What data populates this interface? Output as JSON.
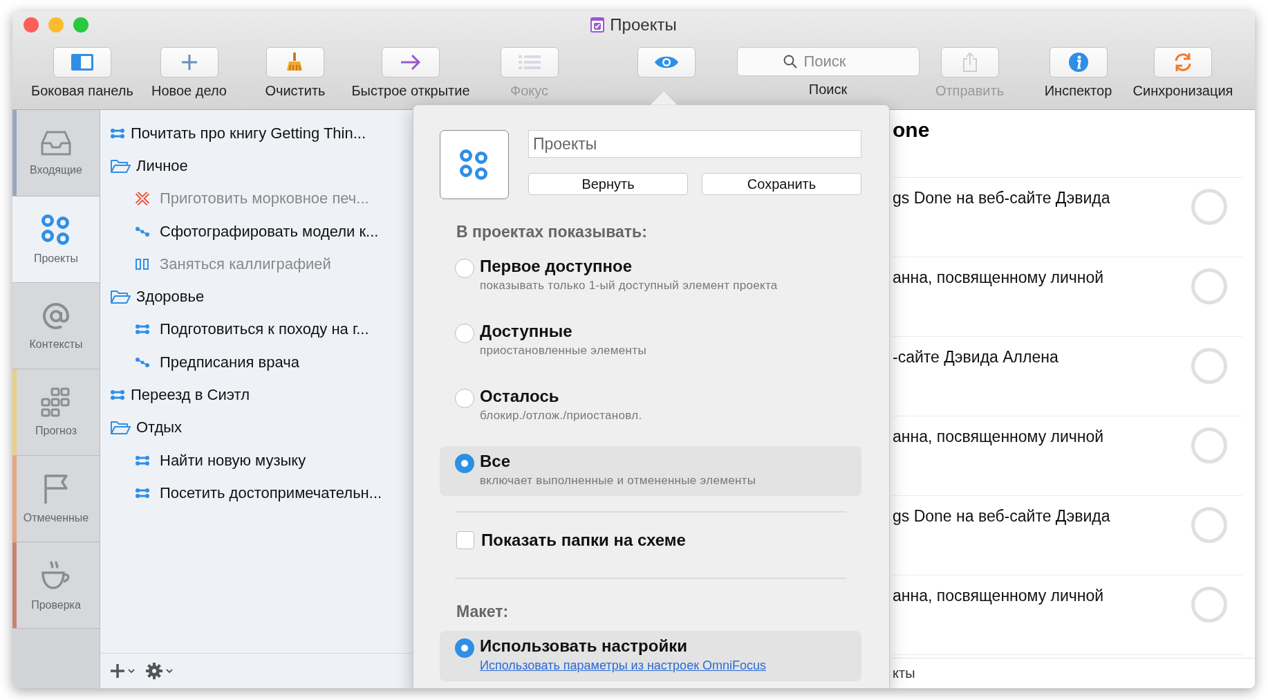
{
  "window": {
    "title": "Проекты"
  },
  "toolbar": [
    {
      "kind": "sidebar",
      "label": "Боковая панель",
      "disabled": false
    },
    {
      "kind": "new",
      "label": "Новое дело",
      "disabled": false
    },
    {
      "kind": "clean",
      "label": "Очистить",
      "disabled": false
    },
    {
      "kind": "quick-open",
      "label": "Быстрое открытие",
      "disabled": false
    },
    {
      "kind": "focus",
      "label": "Фокус",
      "disabled": true
    },
    {
      "kind": "view",
      "disabled": false
    },
    {
      "kind": "search",
      "placeholder": "Поиск",
      "label": "Поиск",
      "disabled": false
    },
    {
      "kind": "share",
      "label": "Отправить",
      "disabled": true
    },
    {
      "kind": "inspector",
      "label": "Инспектор",
      "disabled": false
    },
    {
      "kind": "sync",
      "label": "Синхронизация",
      "disabled": false
    }
  ],
  "sidebar_tabs": [
    {
      "kind": "inbox",
      "label": "Входящие",
      "selected": false,
      "color": "#97a6bb"
    },
    {
      "kind": "projects",
      "label": "Проекты",
      "selected": true
    },
    {
      "kind": "contexts",
      "label": "Контексты",
      "selected": false
    },
    {
      "kind": "forecast",
      "label": "Прогноз",
      "selected": false,
      "color": "#e8cf86"
    },
    {
      "kind": "flagged",
      "label": "Отмеченные",
      "selected": false,
      "color": "#e3a882"
    },
    {
      "kind": "review",
      "label": "Проверка",
      "selected": false,
      "color": "#c88473"
    }
  ],
  "outline": [
    {
      "kind": "parallel",
      "label": "Почитать про книгу Getting Thin...",
      "dimmed": false
    },
    {
      "kind": "folder",
      "label": "Личное",
      "dimmed": false,
      "children": [
        {
          "kind": "dropped",
          "label": "Приготовить морковное печ...",
          "dimmed": true
        },
        {
          "kind": "sequential",
          "label": "Сфотографировать модели к...",
          "dimmed": false
        },
        {
          "kind": "on-hold",
          "label": "Заняться каллиграфией",
          "dimmed": true
        }
      ]
    },
    {
      "kind": "folder",
      "label": "Здоровье",
      "dimmed": false,
      "children": [
        {
          "kind": "parallel",
          "label": "Подготовиться к походу на г...",
          "dimmed": false
        },
        {
          "kind": "sequential",
          "label": "Предписания врача",
          "dimmed": false
        }
      ]
    },
    {
      "kind": "parallel",
      "label": "Переезд в Сиэтл",
      "dimmed": false
    },
    {
      "kind": "folder",
      "label": "Отдых",
      "dimmed": false,
      "children": [
        {
          "kind": "parallel",
          "label": "Найти новую музыку",
          "dimmed": false
        },
        {
          "kind": "parallel",
          "label": "Посетить достопримечательн...",
          "dimmed": false
        }
      ]
    }
  ],
  "popover": {
    "name_field": {
      "value": "Проекты"
    },
    "buttons": [
      "Вернуть",
      "Сохранить"
    ],
    "show_heading": "В проектах показывать:",
    "show_options": [
      {
        "title": "Первое доступное",
        "subtitle": "показывать только 1-ый доступный элемент проекта",
        "selected": false
      },
      {
        "title": "Доступные",
        "subtitle": "приостановленные элементы",
        "selected": false
      },
      {
        "title": "Осталось",
        "subtitle": "блокир./отлож./приостановл.",
        "selected": false
      },
      {
        "title": "Все",
        "subtitle": "включает выполненные и отмененные элементы",
        "selected": true
      }
    ],
    "folders_checkbox": {
      "label": "Показать папки на схеме",
      "checked": false
    },
    "layout_heading": "Макет:",
    "layout_options": [
      {
        "title": "Использовать настройки",
        "link": "Использовать параметры из настроек OmniFocus",
        "selected": true
      }
    ]
  },
  "content": {
    "heading": "one",
    "rows": [
      {
        "text": "gs Done на веб-сайте Дэвида",
        "checked": false
      },
      {
        "text": "анна, посвященному личной",
        "checked": false
      },
      {
        "text": "-сайте Дэвида Аллена",
        "checked": false
      },
      {
        "text": "анна, посвященному личной",
        "checked": false
      },
      {
        "text": "gs Done на веб-сайте Дэвида",
        "checked": false
      },
      {
        "text": "анна, посвященному личной",
        "checked": false
      }
    ],
    "footer": "кты"
  }
}
